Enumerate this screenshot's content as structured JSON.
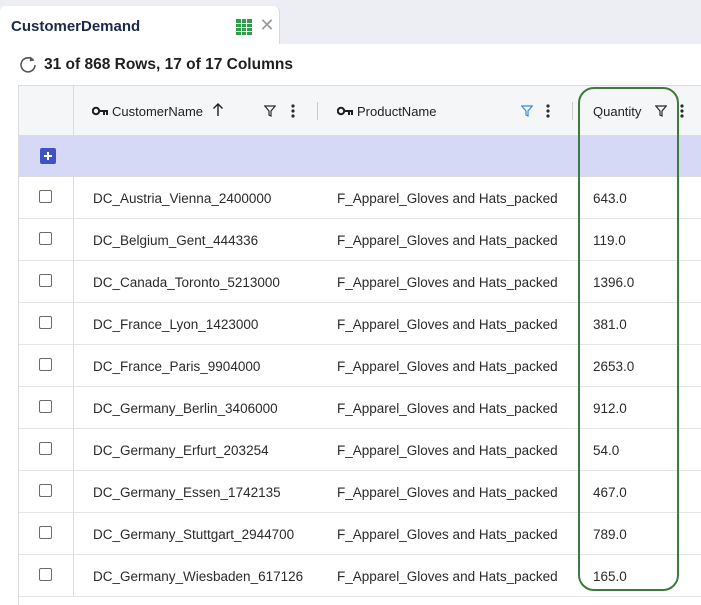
{
  "tab": {
    "title": "CustomerDemand",
    "grid_icon": "grid-icon",
    "close_icon": "close-icon"
  },
  "status": {
    "text": "31 of 868 Rows, 17 of 17 Columns"
  },
  "columns": [
    {
      "label": "CustomerName",
      "key": true,
      "sort": "ascending",
      "filter_color": "#2b2b2b"
    },
    {
      "label": "ProductName",
      "key": true,
      "filter_color": "#3a8dde"
    },
    {
      "label": "Quantity",
      "key": false,
      "filter_color": "#2b2b2b"
    }
  ],
  "rows": [
    {
      "customer": "DC_Austria_Vienna_2400000",
      "product": "F_Apparel_Gloves and Hats_packed",
      "quantity": "643.0"
    },
    {
      "customer": "DC_Belgium_Gent_444336",
      "product": "F_Apparel_Gloves and Hats_packed",
      "quantity": "119.0"
    },
    {
      "customer": "DC_Canada_Toronto_5213000",
      "product": "F_Apparel_Gloves and Hats_packed",
      "quantity": "1396.0"
    },
    {
      "customer": "DC_France_Lyon_1423000",
      "product": "F_Apparel_Gloves and Hats_packed",
      "quantity": "381.0"
    },
    {
      "customer": "DC_France_Paris_9904000",
      "product": "F_Apparel_Gloves and Hats_packed",
      "quantity": "2653.0"
    },
    {
      "customer": "DC_Germany_Berlin_3406000",
      "product": "F_Apparel_Gloves and Hats_packed",
      "quantity": "912.0"
    },
    {
      "customer": "DC_Germany_Erfurt_203254",
      "product": "F_Apparel_Gloves and Hats_packed",
      "quantity": "54.0"
    },
    {
      "customer": "DC_Germany_Essen_1742135",
      "product": "F_Apparel_Gloves and Hats_packed",
      "quantity": "467.0"
    },
    {
      "customer": "DC_Germany_Stuttgart_2944700",
      "product": "F_Apparel_Gloves and Hats_packed",
      "quantity": "789.0"
    },
    {
      "customer": "DC_Germany_Wiesbaden_617126",
      "product": "F_Apparel_Gloves and Hats_packed",
      "quantity": "165.0"
    }
  ],
  "colors": {
    "add_row_background": "#d5d9f6",
    "add_button": "#3f51c4",
    "highlight_outline": "#3d7a3d",
    "grid_icon_green": "#2e9e4a"
  }
}
